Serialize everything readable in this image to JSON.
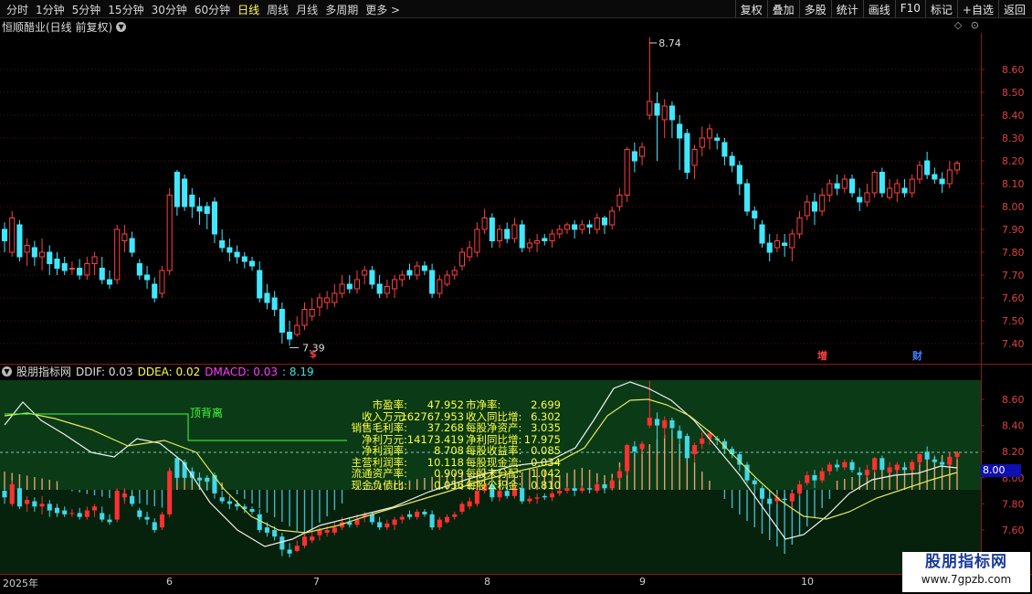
{
  "toolbar": {
    "periods": [
      "分时",
      "1分钟",
      "5分钟",
      "15分钟",
      "30分钟",
      "60分钟",
      "日线",
      "周线",
      "月线",
      "多周期",
      "更多 >"
    ],
    "active_period": "日线",
    "actions": [
      "复权",
      "叠加",
      "多股",
      "统计",
      "画线",
      "F10",
      "标记",
      "+自选",
      "返回"
    ]
  },
  "title": {
    "stock": "恒顺醋业(日线 前复权)",
    "dropdown_icon": "chevron-down-icon"
  },
  "main_chart": {
    "y_ticks": [
      "8.60",
      "8.50",
      "8.40",
      "8.30",
      "8.20",
      "8.10",
      "8.00",
      "7.90",
      "7.80",
      "7.70",
      "7.60",
      "7.50",
      "7.40"
    ],
    "high_label": "8.74",
    "low_label": "7.39",
    "markers": [
      {
        "text": "$",
        "color": "#ff4040"
      },
      {
        "text": "增",
        "color": "#ff4040"
      },
      {
        "text": "财",
        "color": "#4080ff"
      }
    ]
  },
  "indicator": {
    "name": "股朋指标网",
    "ddif_label": "DDIF: 0.03",
    "ddea_label": "DDEA: 0.02",
    "dmacd_label": "DMACD: 0.03",
    "extra_label": ": 8.19",
    "y_ticks": [
      "8.60",
      "8.40",
      "8.20",
      "8.00",
      "7.80",
      "7.60"
    ],
    "price_box": "8.00",
    "top_divergence_label": "顶背离",
    "fundamentals": [
      [
        "市盈率:",
        "47.952",
        "市净率:",
        "2.699"
      ],
      [
        "收入万元:",
        "162767.953",
        "收入同比增:",
        "6.302"
      ],
      [
        "销售毛利率:",
        "37.268",
        "每股净资产:",
        "3.035"
      ],
      [
        "净利万元:",
        "14173.419",
        "净利同比增:",
        "17.975"
      ],
      [
        "净利润率:",
        "8.708",
        "每股收益率:",
        "0.085"
      ],
      [
        "主营利润率:",
        "10.118",
        "每股现金流:",
        "0.034"
      ],
      [
        "流通资产率:",
        "0.909",
        "每股未分配:",
        "1.042"
      ],
      [
        "现金负债比:",
        "0.056",
        "每股公积金:",
        "0.810"
      ]
    ]
  },
  "x_axis": [
    "2025年",
    "6",
    "7",
    "8",
    "9",
    "10"
  ],
  "watermark": {
    "title": "股朋指标网",
    "url": "www.7gpzb.com"
  },
  "colors": {
    "up": "#ff4040",
    "down": "#40e8ff",
    "dif": "#ffffff",
    "dea": "#ffff40",
    "bull_bg": "#0c3a14"
  }
}
